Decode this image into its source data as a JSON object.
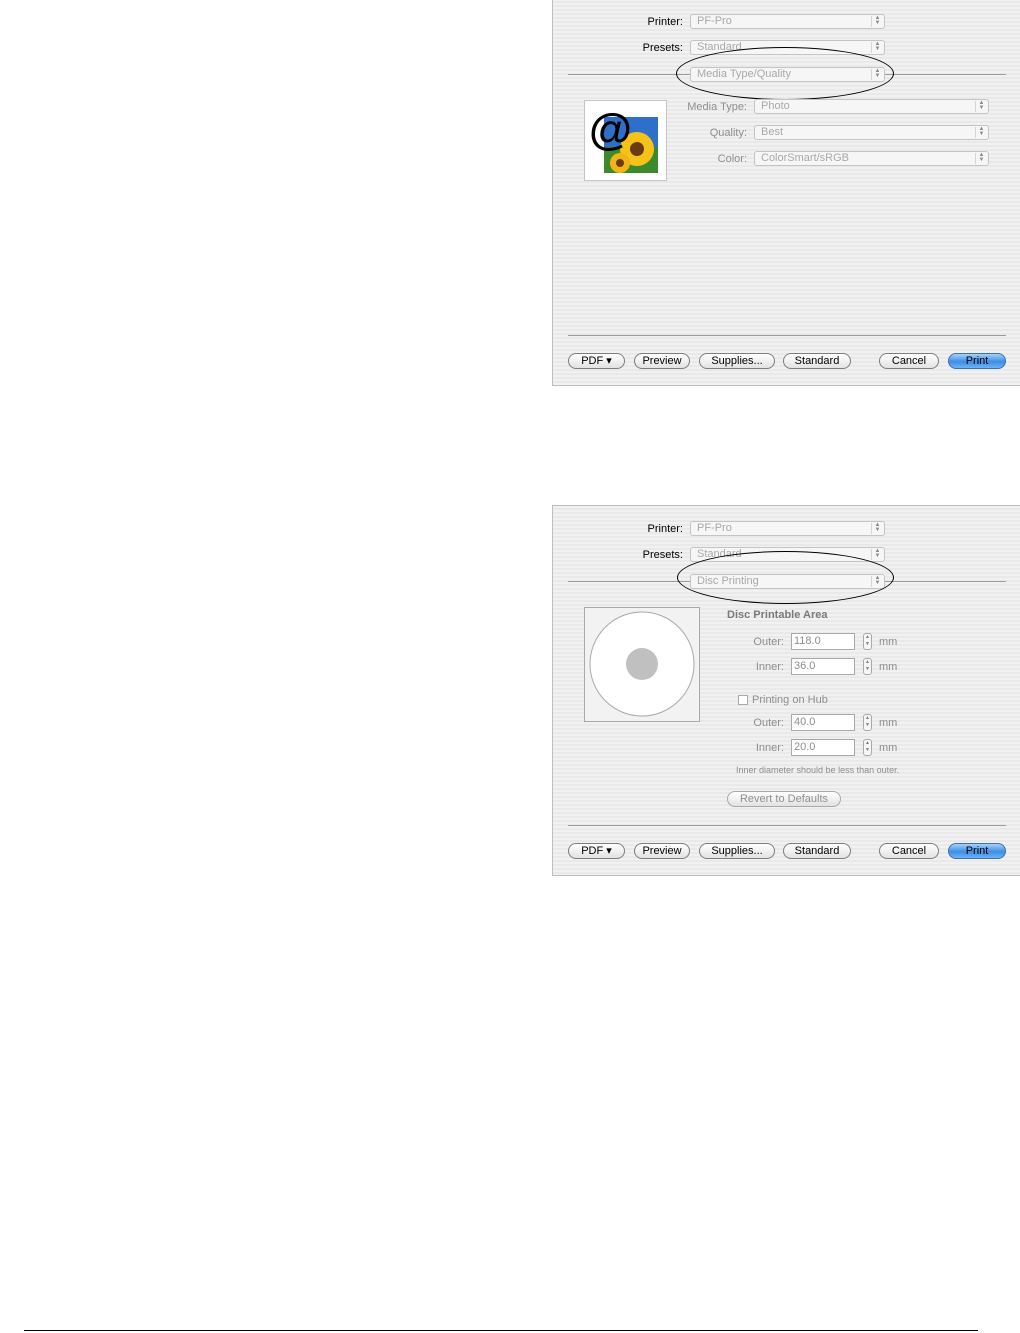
{
  "dialog1": {
    "printer_label": "Printer:",
    "printer_value": "PF-Pro",
    "presets_label": "Presets:",
    "presets_value": "Standard",
    "panel_value": "Media Type/Quality",
    "media_type_label": "Media Type:",
    "media_type_value": "Photo",
    "quality_label": "Quality:",
    "quality_value": "Best",
    "color_label": "Color:",
    "color_value": "ColorSmart/sRGB",
    "buttons": {
      "pdf": "PDF ▾",
      "preview": "Preview",
      "supplies": "Supplies...",
      "standard": "Standard",
      "cancel": "Cancel",
      "print": "Print"
    }
  },
  "dialog2": {
    "printer_label": "Printer:",
    "printer_value": "PF-Pro",
    "presets_label": "Presets:",
    "presets_value": "Standard",
    "panel_value": "Disc Printing",
    "area_heading": "Disc Printable Area",
    "outer_label": "Outer:",
    "outer_value": "118.0",
    "inner_label": "Inner:",
    "inner_value": "36.0",
    "unit": "mm",
    "hub_label": "Printing on Hub",
    "hub_outer_label": "Outer:",
    "hub_outer_value": "40.0",
    "hub_inner_label": "Inner:",
    "hub_inner_value": "20.0",
    "note": "Inner diameter should be less than outer.",
    "revert_button": "Revert to Defaults",
    "buttons": {
      "pdf": "PDF ▾",
      "preview": "Preview",
      "supplies": "Supplies...",
      "standard": "Standard",
      "cancel": "Cancel",
      "print": "Print"
    }
  },
  "colors": {
    "print_button": "#3c8ee6",
    "ellipse": "#000000",
    "disc_hub": "#c0c0c0"
  }
}
